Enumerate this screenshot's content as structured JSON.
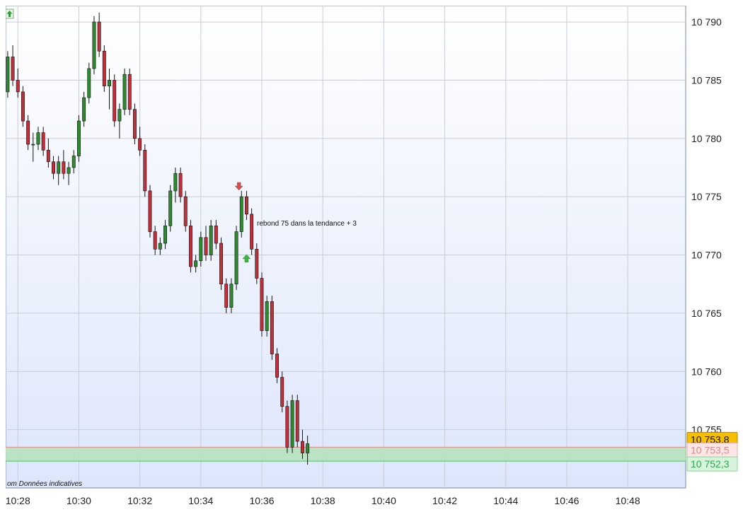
{
  "chart_data": {
    "type": "candlestick",
    "title": "",
    "xlabel": "",
    "ylabel": "",
    "ylim": [
      10750.0,
      10791.4
    ],
    "xlim_minutes": [
      627.6,
      649.9
    ],
    "x_ticks": [
      "10:28",
      "10:30",
      "10:32",
      "10:34",
      "10:36",
      "10:38",
      "10:40",
      "10:42",
      "10:44",
      "10:46",
      "10:48"
    ],
    "y_ticks": [
      "10 755",
      "10 760",
      "10 765",
      "10 770",
      "10 775",
      "10 780",
      "10 785",
      "10 790"
    ],
    "grid": true,
    "colors": {
      "bull": "#2f8a2f",
      "bear": "#c0303a",
      "wick": "#111111",
      "grid": "#c8cdd6",
      "bg_top": "#ffffff",
      "bg_bottom": "#dde6fb",
      "band_fill": "#b5e2bd",
      "band_top_line": "#e08a8a",
      "band_bottom_line": "#4fbf5f",
      "last_box": "#f5c000"
    },
    "price_markers": [
      {
        "label": "10 753,8",
        "value": 10753.8,
        "style": "last"
      },
      {
        "label": "10 753,5",
        "value": 10753.5,
        "style": "ask"
      },
      {
        "label": "10 752,3",
        "value": 10752.3,
        "style": "bid"
      }
    ],
    "band": {
      "top": 10753.5,
      "bottom": 10752.3
    },
    "annotation": "rebond 75 dans la tendance + 3",
    "watermark": "om Données indicatives",
    "signals": [
      {
        "type": "sell",
        "color": "#e04a4a",
        "time": "10:35:15",
        "price": 10775.8
      },
      {
        "type": "buy",
        "color": "#3bb83b",
        "time": "10:35:30",
        "price": 10769.8
      }
    ],
    "top_left_icon": "green-up-arrow-icon",
    "candles": [
      [
        "10:27:30",
        10783.0,
        10784.5,
        10782.0,
        10784.0
      ],
      [
        "10:27:40",
        10784.0,
        10787.5,
        10783.5,
        10787.0
      ],
      [
        "10:27:50",
        10787.0,
        10788.0,
        10784.5,
        10785.0
      ],
      [
        "10:28:00",
        10785.0,
        10786.0,
        10783.5,
        10784.0
      ],
      [
        "10:28:10",
        10784.0,
        10784.5,
        10781.0,
        10781.5
      ],
      [
        "10:28:20",
        10781.5,
        10782.0,
        10779.0,
        10779.5
      ],
      [
        "10:28:30",
        10779.5,
        10780.5,
        10778.0,
        10779.5
      ],
      [
        "10:28:40",
        10779.5,
        10781.0,
        10779.0,
        10780.5
      ],
      [
        "10:28:50",
        10780.5,
        10781.0,
        10778.5,
        10779.0
      ],
      [
        "10:29:00",
        10779.0,
        10780.0,
        10777.5,
        10778.0
      ],
      [
        "10:29:10",
        10778.0,
        10778.5,
        10776.5,
        10777.0
      ],
      [
        "10:29:20",
        10777.0,
        10778.5,
        10776.0,
        10778.0
      ],
      [
        "10:29:30",
        10778.0,
        10779.0,
        10776.5,
        10777.0
      ],
      [
        "10:29:40",
        10777.0,
        10778.0,
        10776.0,
        10777.5
      ],
      [
        "10:29:50",
        10777.5,
        10779.0,
        10777.0,
        10778.5
      ],
      [
        "10:30:00",
        10778.5,
        10782.0,
        10778.0,
        10781.5
      ],
      [
        "10:30:10",
        10781.5,
        10784.0,
        10781.0,
        10783.5
      ],
      [
        "10:30:20",
        10783.5,
        10786.5,
        10783.0,
        10786.0
      ],
      [
        "10:30:30",
        10786.0,
        10790.5,
        10785.5,
        10790.0
      ],
      [
        "10:30:40",
        10790.0,
        10790.8,
        10787.0,
        10787.5
      ],
      [
        "10:30:50",
        10787.5,
        10788.0,
        10784.0,
        10784.5
      ],
      [
        "10:31:00",
        10784.5,
        10786.0,
        10782.5,
        10785.0
      ],
      [
        "10:31:10",
        10785.0,
        10785.5,
        10781.0,
        10781.5
      ],
      [
        "10:31:20",
        10781.5,
        10783.0,
        10780.0,
        10782.5
      ],
      [
        "10:31:30",
        10782.5,
        10786.0,
        10782.0,
        10785.5
      ],
      [
        "10:31:40",
        10785.5,
        10786.0,
        10782.0,
        10782.5
      ],
      [
        "10:31:50",
        10782.5,
        10783.0,
        10779.5,
        10780.0
      ],
      [
        "10:32:00",
        10780.0,
        10781.0,
        10778.5,
        10779.0
      ],
      [
        "10:32:10",
        10779.0,
        10779.5,
        10775.0,
        10775.5
      ],
      [
        "10:32:20",
        10775.5,
        10776.0,
        10771.5,
        10772.0
      ],
      [
        "10:32:30",
        10772.0,
        10772.5,
        10770.0,
        10770.5
      ],
      [
        "10:32:40",
        10770.5,
        10771.5,
        10770.0,
        10771.0
      ],
      [
        "10:32:50",
        10771.0,
        10773.0,
        10770.5,
        10772.5
      ],
      [
        "10:33:00",
        10772.5,
        10776.0,
        10772.0,
        10775.5
      ],
      [
        "10:33:10",
        10775.5,
        10777.5,
        10774.5,
        10777.0
      ],
      [
        "10:33:20",
        10777.0,
        10777.5,
        10774.5,
        10775.0
      ],
      [
        "10:33:30",
        10775.0,
        10775.5,
        10772.0,
        10772.5
      ],
      [
        "10:33:40",
        10772.5,
        10773.0,
        10768.5,
        10769.0
      ],
      [
        "10:33:50",
        10769.0,
        10770.0,
        10768.5,
        10769.5
      ],
      [
        "10:34:00",
        10769.5,
        10772.0,
        10769.0,
        10771.5
      ],
      [
        "10:34:10",
        10771.5,
        10772.5,
        10769.5,
        10770.0
      ],
      [
        "10:34:20",
        10770.0,
        10773.0,
        10769.5,
        10772.5
      ],
      [
        "10:34:30",
        10772.5,
        10773.0,
        10770.5,
        10771.0
      ],
      [
        "10:34:40",
        10771.0,
        10771.5,
        10767.0,
        10767.5
      ],
      [
        "10:34:50",
        10767.5,
        10768.0,
        10765.0,
        10765.5
      ],
      [
        "10:35:00",
        10765.5,
        10768.0,
        10765.0,
        10767.5
      ],
      [
        "10:35:10",
        10767.5,
        10772.5,
        10767.0,
        10772.0
      ],
      [
        "10:35:20",
        10772.0,
        10775.5,
        10771.5,
        10775.0
      ],
      [
        "10:35:30",
        10775.0,
        10775.5,
        10773.0,
        10773.5
      ],
      [
        "10:35:40",
        10773.5,
        10774.0,
        10770.0,
        10770.5
      ],
      [
        "10:35:50",
        10770.5,
        10771.0,
        10767.5,
        10768.0
      ],
      [
        "10:36:00",
        10768.0,
        10768.5,
        10763.0,
        10763.5
      ],
      [
        "10:36:10",
        10763.5,
        10766.5,
        10763.0,
        10766.0
      ],
      [
        "10:36:20",
        10766.0,
        10766.5,
        10761.0,
        10761.5
      ],
      [
        "10:36:30",
        10761.5,
        10762.0,
        10759.0,
        10759.5
      ],
      [
        "10:36:40",
        10759.5,
        10760.0,
        10756.5,
        10757.0
      ],
      [
        "10:36:50",
        10757.0,
        10757.5,
        10753.0,
        10753.5
      ],
      [
        "10:37:00",
        10753.5,
        10758.0,
        10753.0,
        10757.5
      ],
      [
        "10:37:10",
        10757.5,
        10758.0,
        10753.5,
        10754.0
      ],
      [
        "10:37:20",
        10754.0,
        10755.0,
        10752.5,
        10753.0
      ],
      [
        "10:37:30",
        10753.0,
        10754.5,
        10752.0,
        10753.8
      ]
    ]
  }
}
